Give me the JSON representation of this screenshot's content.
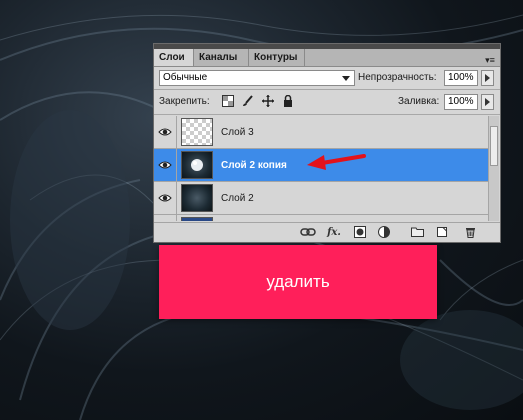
{
  "colors": {
    "accent": "#3d8be9",
    "delete_button": "#ff1f5a",
    "arrow": "#e3121b"
  },
  "panel": {
    "tabs": [
      {
        "label": "Слои"
      },
      {
        "label": "Каналы"
      },
      {
        "label": "Контуры"
      }
    ],
    "blend_mode": "Обычные",
    "opacity_label": "Непрозрачность:",
    "opacity_value": "100%",
    "lock_label": "Закрепить:",
    "fill_label": "Заливка:",
    "fill_value": "100%",
    "layers": [
      {
        "name": "Слой 3",
        "visible": true,
        "selected": false,
        "thumb": "transparent"
      },
      {
        "name": "Слой 2 копия",
        "visible": true,
        "selected": true,
        "thumb": "dark-circle"
      },
      {
        "name": "Слой 2",
        "visible": true,
        "selected": false,
        "thumb": "dark-texture"
      }
    ],
    "bottom_icons": [
      "link-icon",
      "fx-icon",
      "mask-icon",
      "adjustment-icon",
      "group-icon",
      "new-layer-icon",
      "trash-icon"
    ],
    "fx_label": "fx."
  },
  "delete_button": {
    "label": "удалить"
  }
}
